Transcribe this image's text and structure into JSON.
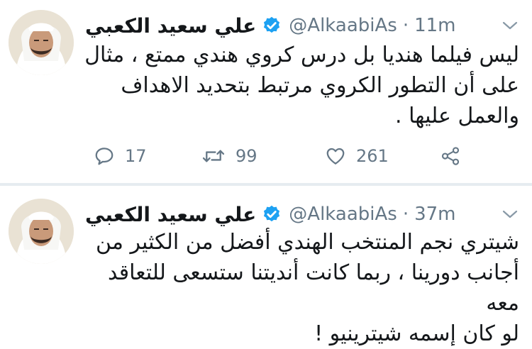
{
  "tweets": [
    {
      "author_name": "علي سعيد الكعبي",
      "handle": "@AlkaabiAs",
      "separator": "·",
      "time": "11m",
      "text_lines": [
        "ليس فيلما هنديا بل درس كروي هندي ممتع ، مثال",
        "على أن التطور الكروي مرتبط بتحديد الاهداف",
        "والعمل عليها ."
      ],
      "replies": "17",
      "retweets": "99",
      "likes": "261"
    },
    {
      "author_name": "علي سعيد الكعبي",
      "handle": "@AlkaabiAs",
      "separator": "·",
      "time": "37m",
      "text_lines": [
        "شيتري نجم المنتخب الهندي أفضل من الكثير من",
        "أجانب دورينا ، ربما كانت أنديتنا ستسعى للتعاقد معه",
        "لو كان إسمه شيترينيو !"
      ]
    }
  ],
  "icons": {
    "verified": "verified-badge-icon",
    "chevron": "chevron-down-icon",
    "reply": "reply-icon",
    "retweet": "retweet-icon",
    "like": "heart-icon",
    "share": "share-icon"
  },
  "colors": {
    "verified": "#1da1f2",
    "secondary_text": "#657786",
    "primary_text": "#14171a",
    "divider": "#e6ecf0"
  }
}
